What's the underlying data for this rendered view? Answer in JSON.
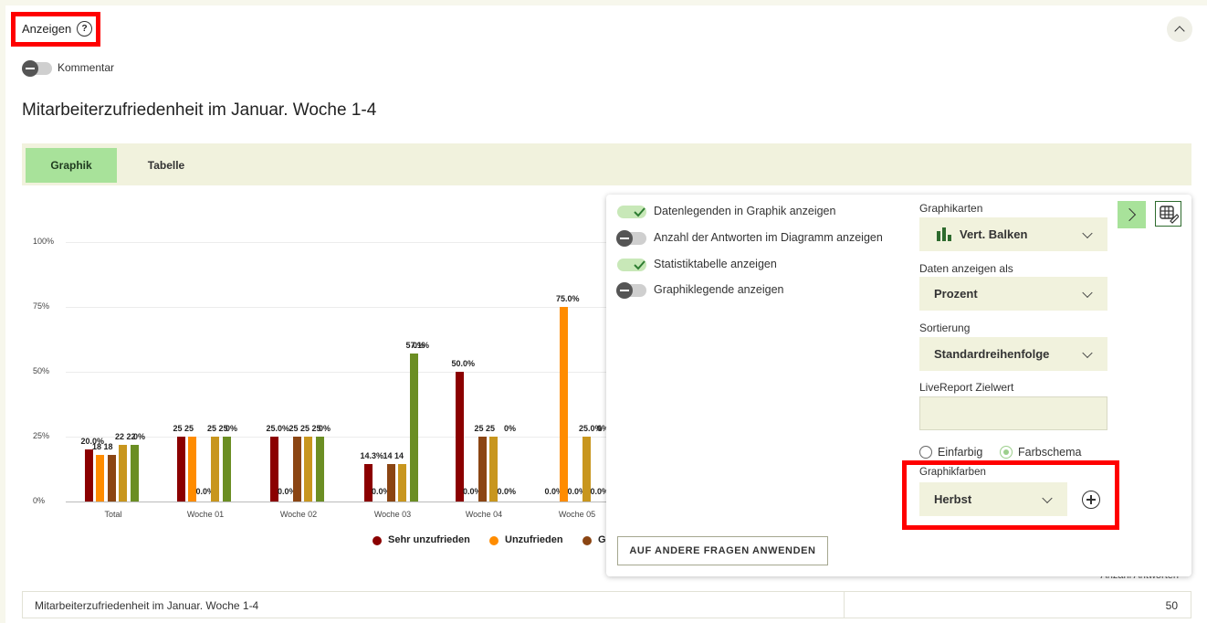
{
  "header": {
    "title": "Anzeigen",
    "help_icon": "?",
    "comment_toggle_label": "Kommentar",
    "comment_toggle_on": false
  },
  "question_title": "Mitarbeiterzufriedenheit im Januar. Woche 1-4",
  "tabs": [
    {
      "label": "Graphik",
      "active": true
    },
    {
      "label": "Tabelle",
      "active": false
    }
  ],
  "chart_data": {
    "type": "bar",
    "categories": [
      "Total",
      "Woche 01",
      "Woche 02",
      "Woche 03",
      "Woche 04",
      "Woche 05"
    ],
    "ylim": [
      0,
      100
    ],
    "yticks": [
      "100%",
      "75%",
      "50%",
      "25%",
      "0%"
    ],
    "series": [
      {
        "name": "Sehr unzufrieden",
        "color": "#8b0000",
        "values": [
          20.0,
          25.0,
          25.0,
          14.3,
          50.0,
          0.0
        ],
        "labels": [
          "20.0%",
          "25",
          "25.0%",
          "14.3%",
          "50.0%",
          "0.0%"
        ]
      },
      {
        "name": "Unzufrieden",
        "color": "#ff8c00",
        "values": [
          18.0,
          25.0,
          0.0,
          0.0,
          0.0,
          75.0
        ],
        "labels": [
          "18",
          "25",
          "0.0%",
          "0.0%",
          "0.0%",
          "75.0%"
        ]
      },
      {
        "name": "G",
        "color": "#8b4513",
        "values": [
          18.0,
          0.0,
          25.0,
          14.3,
          25.0,
          0.0
        ],
        "labels": [
          "18",
          "0.0%",
          "25",
          "14",
          "25",
          "0.0%"
        ]
      },
      {
        "name": "",
        "color": "#c8961e",
        "values": [
          22.0,
          25.0,
          25.0,
          14.3,
          25.0,
          25.0
        ],
        "labels": [
          "22",
          "25",
          "25",
          "14",
          "25",
          "25.0%"
        ]
      },
      {
        "name": "",
        "color": "#6b8e23",
        "values": [
          22.0,
          25.0,
          25.0,
          57.1,
          0.0,
          0.0
        ],
        "labels": [
          "22",
          "25",
          "25",
          "57.1%",
          "0.0%",
          "0.0%"
        ]
      }
    ],
    "clip_label": "0.0%",
    "legend_labels": [
      "Sehr unzufrieden",
      "Unzufrieden",
      "G"
    ],
    "extra_labels": [
      "0%",
      "0%",
      "0%",
      "0%",
      "0%",
      "0%"
    ]
  },
  "settings": {
    "toggles": [
      {
        "label": "Datenlegenden in Graphik anzeigen",
        "on": true
      },
      {
        "label": "Anzahl der Antworten im Diagramm anzeigen",
        "on": false
      },
      {
        "label": "Statistiktabelle anzeigen",
        "on": true
      },
      {
        "label": "Graphiklegende anzeigen",
        "on": false
      }
    ],
    "graph_type_label": "Graphikarten",
    "graph_type_value": "Vert. Balken",
    "display_as_label": "Daten anzeigen als",
    "display_as_value": "Prozent",
    "sort_label": "Sortierung",
    "sort_value": "Standardreihenfolge",
    "target_label": "LiveReport Zielwert",
    "target_value": "",
    "radio_single": "Einfarbig",
    "radio_scheme": "Farbschema",
    "radio_selected": "Farbschema",
    "colors_label": "Graphikfarben",
    "colors_value": "Herbst",
    "apply_button": "AUF ANDERE FRAGEN ANWENDEN"
  },
  "table": {
    "count_header": "Anzahl Antworten",
    "row_label": "Mitarbeiterzufriedenheit im Januar. Woche 1-4",
    "row_value": "50"
  },
  "colors": {
    "accent_green": "#a8e29a",
    "panel_bg": "#f1f2dd",
    "highlight": "#ff0000"
  }
}
